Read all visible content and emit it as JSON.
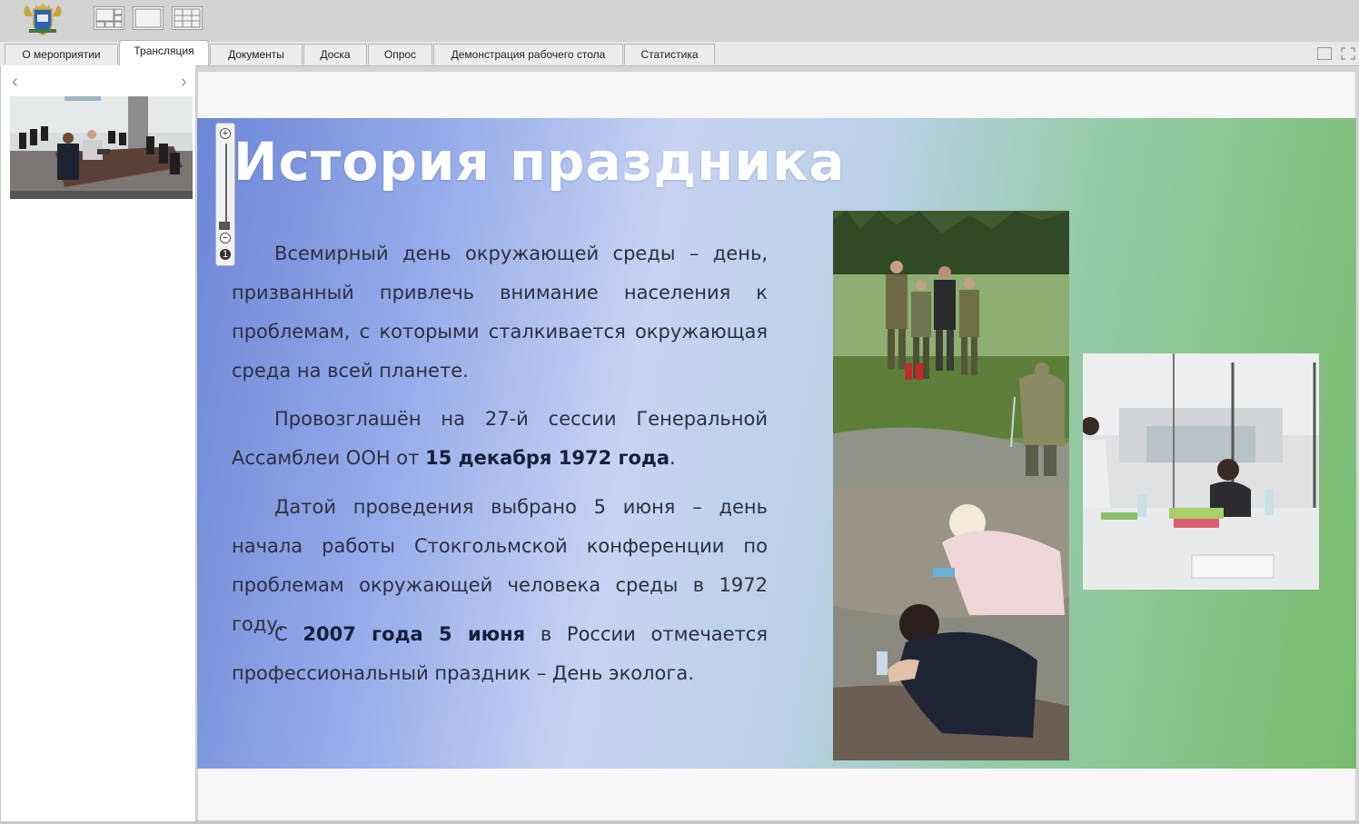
{
  "app": {
    "tabs": [
      {
        "label": "О мероприятии",
        "active": false
      },
      {
        "label": "Трансляция",
        "active": true
      },
      {
        "label": "Документы",
        "active": false
      },
      {
        "label": "Доска",
        "active": false
      },
      {
        "label": "Опрос",
        "active": false
      },
      {
        "label": "Демонстрация рабочего стола",
        "active": false
      },
      {
        "label": "Статистика",
        "active": false
      }
    ],
    "layout_buttons": [
      "layout-split-icon",
      "layout-single-icon",
      "layout-grid-icon"
    ],
    "window_buttons": [
      "restore-window-icon",
      "fullscreen-icon"
    ],
    "left_panel": {
      "prev_icon": "chevron-left-icon",
      "next_icon": "chevron-right-icon",
      "prev_glyph": "‹",
      "next_glyph": "›"
    }
  },
  "slide": {
    "title": "История праздника",
    "p1": "Всемирный день окружающей среды – день, призванный привлечь внимание населения к проблемам, с которыми сталкивается окружающая среда на всей планете.",
    "p2_start": "Провозглашён на 27-й сессии Генеральной Ассамблеи ООН от ",
    "p2_bold": "15 декабря 1972 года",
    "p2_end": ".",
    "p3": "Датой проведения выбрано 5 июня – день начала работы Стокгольмской конференции по проблемам окружающей человека среды в 1972 году.",
    "p4_start": "С ",
    "p4_bold": "2007 года 5 июня",
    "p4_end": " в России отмечается профессиональный праздник – День эколога."
  },
  "zoom": {
    "plus": "+",
    "minus": "−",
    "one": "1"
  },
  "colors": {
    "accent_title": "#ffffff",
    "text": "#2b3140",
    "tab_active_bg": "#ffffff"
  }
}
